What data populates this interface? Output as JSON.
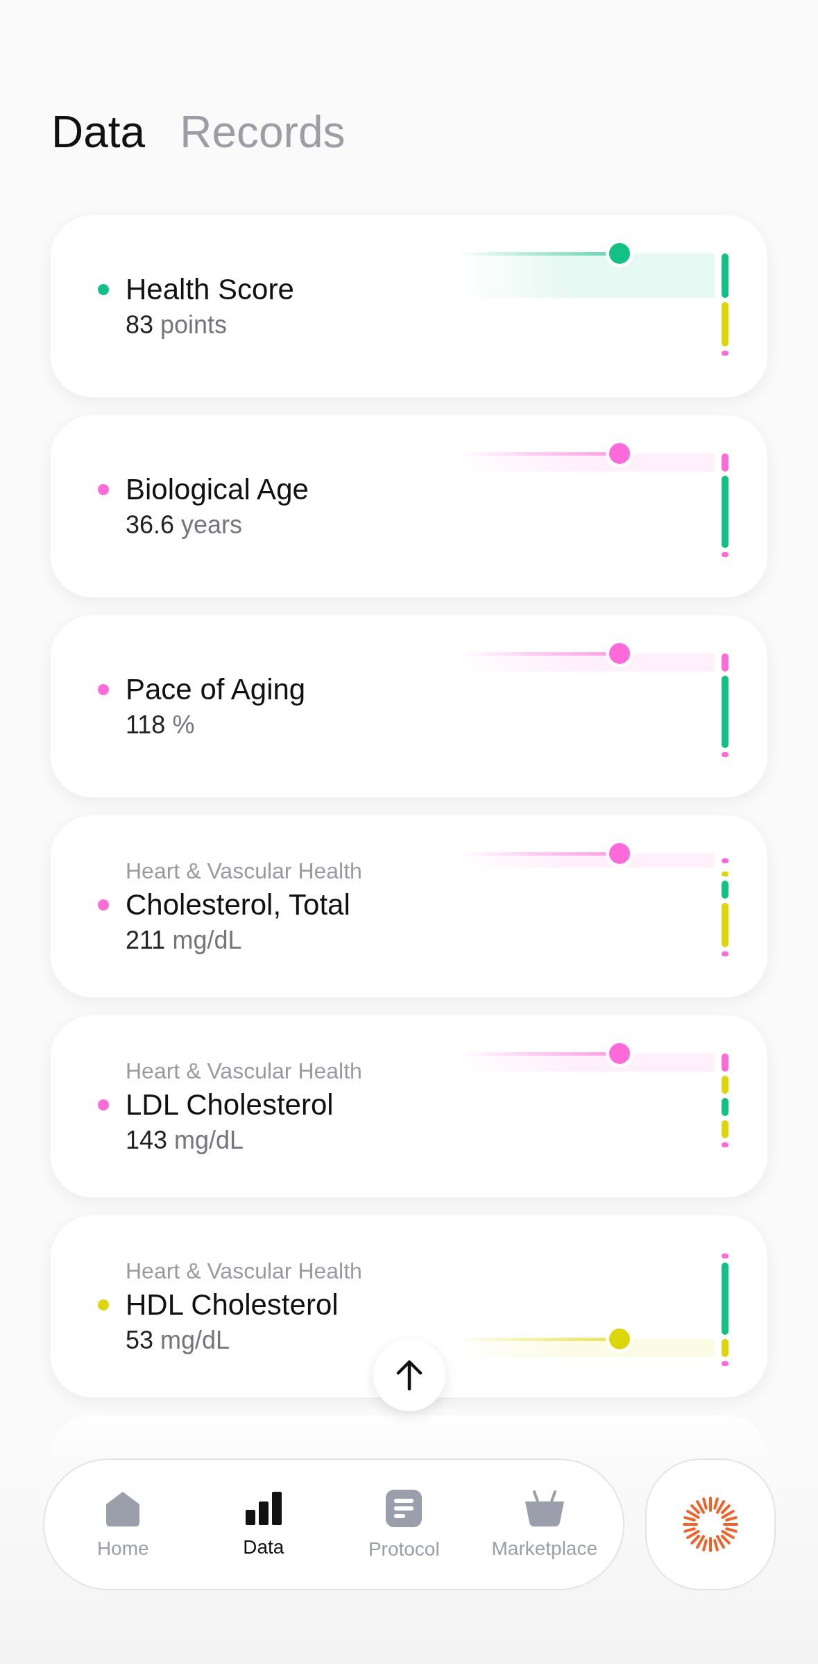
{
  "tabs": [
    {
      "label": "Data",
      "selected": true
    },
    {
      "label": "Records",
      "selected": false
    }
  ],
  "metrics": [
    {
      "name": "Health Score",
      "value": "83",
      "unit": "points",
      "color": "#12c184",
      "level": 0.63,
      "segments": [
        {
          "color": "#12c184",
          "kind": "mid",
          "current": true
        },
        {
          "color": "#dcd60a",
          "kind": "mid",
          "current": false
        },
        {
          "color": "#ff6ad9",
          "kind": "dot",
          "current": false
        }
      ]
    },
    {
      "name": "Biological Age",
      "value": "36.6",
      "unit": "years",
      "color": "#ff6ad9",
      "level": 0.63,
      "segments": [
        {
          "color": "#ff6ad9",
          "kind": "short",
          "current": true
        },
        {
          "color": "#12c184",
          "kind": "long",
          "current": false
        },
        {
          "color": "#ff6ad9",
          "kind": "dot",
          "current": false
        }
      ]
    },
    {
      "name": "Pace of Aging",
      "value": "118",
      "unit": "%",
      "color": "#ff6ad9",
      "level": 0.63,
      "segments": [
        {
          "color": "#ff6ad9",
          "kind": "short",
          "current": true
        },
        {
          "color": "#12c184",
          "kind": "long",
          "current": false
        },
        {
          "color": "#ff6ad9",
          "kind": "dot",
          "current": false
        }
      ]
    },
    {
      "category": "Heart & Vascular Health",
      "name": "Cholesterol, Total",
      "value": "211",
      "unit": "mg/dL",
      "color": "#ff6ad9",
      "level": 0.63,
      "segments": [
        {
          "color": "#ff6ad9",
          "kind": "dot",
          "current": true
        },
        {
          "color": "#dcd60a",
          "kind": "dot",
          "current": false
        },
        {
          "color": "#12c184",
          "kind": "short",
          "current": false
        },
        {
          "color": "#dcd60a",
          "kind": "mid",
          "current": false
        },
        {
          "color": "#ff6ad9",
          "kind": "dot",
          "current": false
        }
      ]
    },
    {
      "category": "Heart & Vascular Health",
      "name": "LDL Cholesterol",
      "value": "143",
      "unit": "mg/dL",
      "color": "#ff6ad9",
      "level": 0.63,
      "segments": [
        {
          "color": "#ff6ad9",
          "kind": "short",
          "current": true
        },
        {
          "color": "#dcd60a",
          "kind": "short",
          "current": false
        },
        {
          "color": "#12c184",
          "kind": "short",
          "current": false
        },
        {
          "color": "#dcd60a",
          "kind": "short",
          "current": false
        },
        {
          "color": "#ff6ad9",
          "kind": "dot",
          "current": false
        }
      ]
    },
    {
      "category": "Heart & Vascular Health",
      "name": "HDL Cholesterol",
      "value": "53",
      "unit": "mg/dL",
      "color": "#dcd60a",
      "level": 0.63,
      "segments": [
        {
          "color": "#ff6ad9",
          "kind": "dot",
          "current": false
        },
        {
          "color": "#12c184",
          "kind": "long",
          "current": false
        },
        {
          "color": "#dcd60a",
          "kind": "short",
          "current": true
        },
        {
          "color": "#ff6ad9",
          "kind": "dot",
          "current": false
        }
      ]
    }
  ],
  "nav": {
    "items": [
      {
        "label": "Home",
        "kind": "home",
        "selected": false
      },
      {
        "label": "Data",
        "kind": "data",
        "selected": true
      },
      {
        "label": "Protocol",
        "kind": "protocol",
        "selected": false
      },
      {
        "label": "Marketplace",
        "kind": "marketplace",
        "selected": false
      }
    ]
  }
}
